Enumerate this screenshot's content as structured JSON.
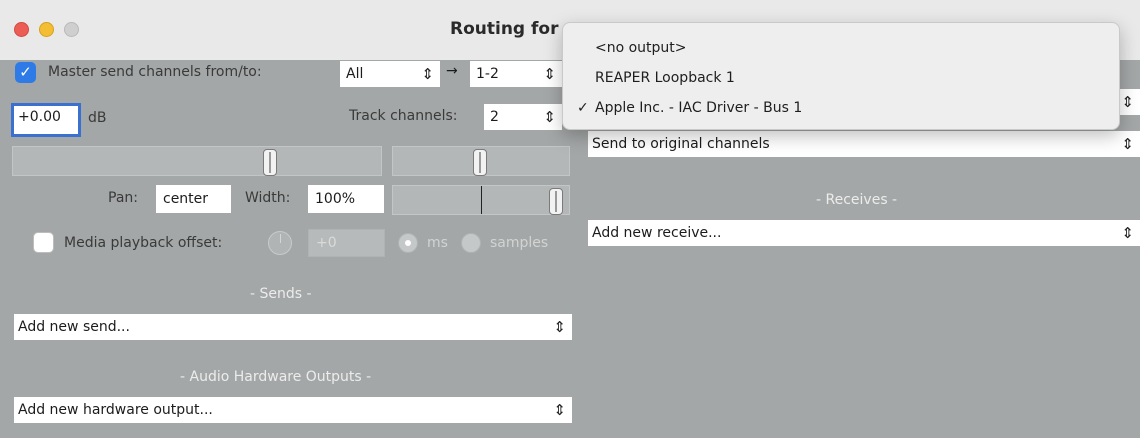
{
  "window": {
    "title": "Routing for"
  },
  "master": {
    "label": "Master send channels from/to:",
    "from_value": "All",
    "to_value": "1-2",
    "arrow": "→",
    "checked_glyph": "✓"
  },
  "volume": {
    "value": "+0.00",
    "unit": "dB"
  },
  "track_channels": {
    "label": "Track channels:",
    "value": "2"
  },
  "pan": {
    "label": "Pan:",
    "value": "center"
  },
  "width": {
    "label": "Width:",
    "value": "100%"
  },
  "media_offset": {
    "label": "Media playback offset:",
    "value": "+0",
    "unit_ms": "ms",
    "unit_samples": "samples"
  },
  "sends": {
    "header": "- Sends -",
    "add_label": "Add new send..."
  },
  "hardware": {
    "header": "- Audio Hardware Outputs -",
    "add_label": "Add new hardware output..."
  },
  "right": {
    "send_channels": "Send to original channels",
    "receives_header": "- Receives -",
    "add_receive": "Add new receive..."
  },
  "dropdown_menu": {
    "items": [
      {
        "label": "<no output>",
        "checked": false
      },
      {
        "label": "REAPER Loopback 1",
        "checked": false
      },
      {
        "label": "Apple Inc. - IAC Driver - Bus 1",
        "checked": true
      }
    ],
    "check_glyph": "✓"
  },
  "chevron": "⌃⌄",
  "colors": {
    "window_bg": "#a4a7a7",
    "accent_blue": "#2e7be8",
    "close": "#ec5d56",
    "minimize": "#f3be33"
  }
}
